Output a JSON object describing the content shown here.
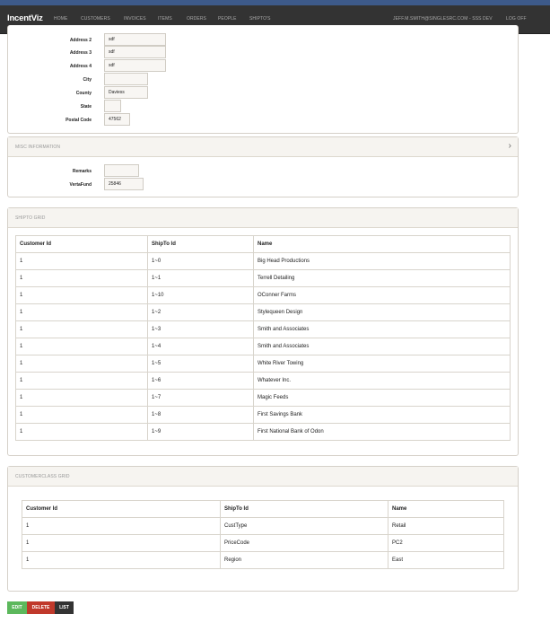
{
  "nav": {
    "brand": "IncentViz",
    "items": [
      "HOME",
      "CUSTOMERS",
      "INVOICES",
      "ITEMS",
      "ORDERS",
      "PEOPLE",
      "SHIPTO'S"
    ],
    "user": "JEFF.M.SMITH@SINGLESRC.COM - SSS DEV",
    "logoff": "LOG OFF"
  },
  "address": {
    "address2_label": "Address 2",
    "address2": "sdf",
    "address3_label": "Address 3",
    "address3": "sdf",
    "address4_label": "Address 4",
    "address4": "sdf",
    "city_label": "City",
    "city": "",
    "county_label": "County",
    "county": "Daviess",
    "state_label": "State",
    "state": "",
    "postal_label": "Postal Code",
    "postal": "47562"
  },
  "misc": {
    "title": "MISC INFORMATION",
    "remarks_label": "Remarks",
    "remarks": "",
    "vertafund_label": "VertaFund",
    "vertafund": "25846"
  },
  "shipto_grid": {
    "title": "SHIPTO GRID",
    "headers": [
      "Customer Id",
      "ShipTo Id",
      "Name"
    ],
    "rows": [
      [
        "1",
        "1~0",
        "Big Head Productions"
      ],
      [
        "1",
        "1~1",
        "Terrell Detailing"
      ],
      [
        "1",
        "1~10",
        "OConner Farms"
      ],
      [
        "1",
        "1~2",
        "Stylequeen Design"
      ],
      [
        "1",
        "1~3",
        "Smith and Associates"
      ],
      [
        "1",
        "1~4",
        "Smith and Associates"
      ],
      [
        "1",
        "1~5",
        "White River Towing"
      ],
      [
        "1",
        "1~6",
        "Whatever Inc."
      ],
      [
        "1",
        "1~7",
        "Magic Feeds"
      ],
      [
        "1",
        "1~8",
        "First Savings Bank"
      ],
      [
        "1",
        "1~9",
        "First National Bank of Odon"
      ]
    ]
  },
  "customerclass_grid": {
    "title": "CUSTOMERCLASS GRID",
    "headers": [
      "Customer Id",
      "ShipTo Id",
      "Name"
    ],
    "rows": [
      [
        "1",
        "CustType",
        "Retail"
      ],
      [
        "1",
        "PriceCode",
        "PC2"
      ],
      [
        "1",
        "Region",
        "East"
      ]
    ]
  },
  "actions": {
    "edit": "EDIT",
    "delete": "DELETE",
    "list": "LIST"
  },
  "colors": {
    "edit": "#5cb85c",
    "delete": "#c0392b",
    "list": "#333333",
    "navbar": "#333333"
  },
  "icons": {
    "misc_toggle": "chevron-right-icon"
  }
}
